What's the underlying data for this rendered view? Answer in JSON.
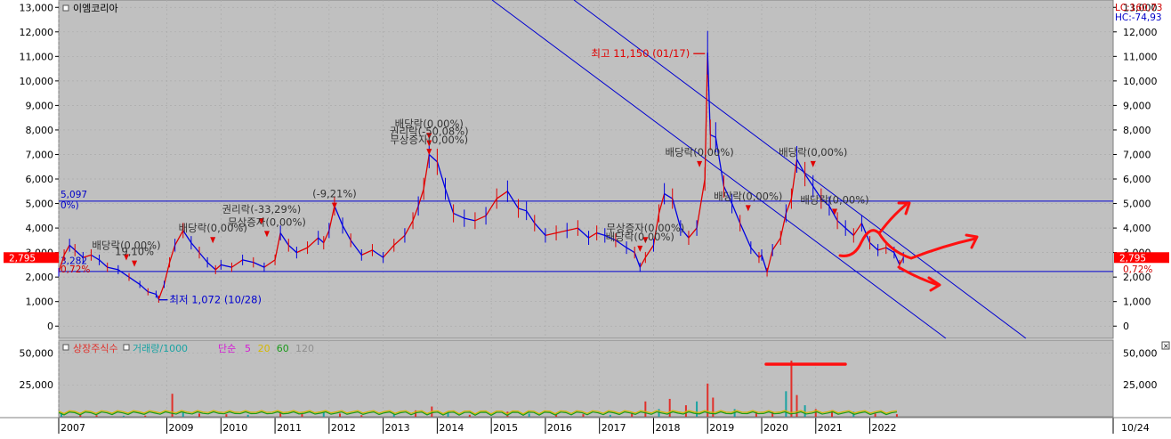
{
  "chart_data": {
    "type": "line",
    "title": "이엠코리아",
    "lc_label": "LC:160,73",
    "hc_label": "HC:-74,93",
    "price_axis": {
      "ticks": [
        0,
        1000,
        2000,
        3000,
        4000,
        5000,
        6000,
        7000,
        8000,
        9000,
        10000,
        11000,
        12000,
        13000
      ],
      "tick_labels": [
        "0",
        "1,000",
        "2,000",
        "3,000",
        "4,000",
        "5,000",
        "6,000",
        "7,000",
        "8,000",
        "9,000",
        "10,000",
        "11,000",
        "12,000",
        "13,000"
      ],
      "ylim": [
        -500,
        13300
      ]
    },
    "x_axis": {
      "xlim": [
        2007.0,
        2026.5
      ],
      "year_labels": [
        "2007",
        "2009",
        "2010",
        "2011",
        "2012",
        "2013",
        "2014",
        "2015",
        "2016",
        "2017",
        "2018",
        "2019",
        "2020",
        "2021",
        "2022"
      ],
      "year_positions": [
        2007,
        2009,
        2010,
        2011,
        2012,
        2013,
        2014,
        2015,
        2016,
        2017,
        2018,
        2019,
        2020,
        2021,
        2022
      ],
      "end_label": "10/24"
    },
    "current_price_label": "2,795",
    "current_price": 2795,
    "ref_lines": [
      {
        "value": 5097,
        "label": "5,097"
      },
      {
        "value": 2230,
        "label": "0,72%"
      }
    ],
    "right_pct_label": "0,72%",
    "left_small_labels": [
      "0%)",
      "3,282"
    ],
    "high_annotation": {
      "label": "최고 11,150 (01/17)",
      "date": 2019.0,
      "value": 11150
    },
    "low_annotation": {
      "label": "최저 1,072 (10/28)",
      "date": 2008.85,
      "value": 1072
    },
    "price_series": {
      "x": [
        2007.0,
        2007.1,
        2007.2,
        2007.3,
        2007.45,
        2007.6,
        2007.75,
        2007.9,
        2008.1,
        2008.3,
        2008.5,
        2008.65,
        2008.8,
        2008.85,
        2008.95,
        2009.05,
        2009.15,
        2009.3,
        2009.45,
        2009.6,
        2009.75,
        2009.9,
        2010.0,
        2010.2,
        2010.4,
        2010.6,
        2010.8,
        2011.0,
        2011.1,
        2011.25,
        2011.4,
        2011.6,
        2011.8,
        2011.9,
        2012.0,
        2012.1,
        2012.25,
        2012.4,
        2012.6,
        2012.8,
        2013.0,
        2013.2,
        2013.4,
        2013.55,
        2013.65,
        2013.75,
        2013.85,
        2014.0,
        2014.15,
        2014.3,
        2014.5,
        2014.7,
        2014.9,
        2015.1,
        2015.3,
        2015.5,
        2015.65,
        2015.8,
        2016.0,
        2016.2,
        2016.4,
        2016.6,
        2016.8,
        2016.95,
        2017.1,
        2017.3,
        2017.5,
        2017.65,
        2017.75,
        2017.85,
        2018.0,
        2018.1,
        2018.2,
        2018.35,
        2018.5,
        2018.65,
        2018.8,
        2018.95,
        2019.0,
        2019.05,
        2019.15,
        2019.3,
        2019.45,
        2019.6,
        2019.8,
        2019.95,
        2020.0,
        2020.1,
        2020.2,
        2020.35,
        2020.45,
        2020.55,
        2020.65,
        2020.8,
        2020.95,
        2021.1,
        2021.25,
        2021.4,
        2021.55,
        2021.7,
        2021.85,
        2022.0,
        2022.15,
        2022.3,
        2022.45,
        2022.55,
        2022.62
      ],
      "y": [
        2200,
        2900,
        3300,
        3100,
        2800,
        2900,
        2700,
        2400,
        2300,
        2000,
        1700,
        1400,
        1300,
        1100,
        1700,
        2600,
        3300,
        3900,
        3400,
        3000,
        2600,
        2300,
        2500,
        2400,
        2700,
        2600,
        2400,
        2700,
        3800,
        3300,
        3000,
        3200,
        3600,
        3400,
        3900,
        4900,
        4100,
        3500,
        2900,
        3100,
        2800,
        3300,
        3700,
        4300,
        4900,
        5600,
        7000,
        6700,
        5600,
        4600,
        4400,
        4300,
        4500,
        5200,
        5500,
        4800,
        4700,
        4200,
        3700,
        3800,
        3900,
        4000,
        3600,
        3800,
        3700,
        3500,
        3200,
        3000,
        2400,
        2800,
        3300,
        4600,
        5400,
        5200,
        4000,
        3600,
        4000,
        6000,
        11150,
        7800,
        7700,
        5700,
        5000,
        4200,
        3200,
        2800,
        2900,
        2200,
        3100,
        3600,
        4600,
        5200,
        6800,
        6200,
        5700,
        5200,
        4900,
        4300,
        4000,
        3700,
        4200,
        3400,
        3100,
        3200,
        3000,
        2500,
        2795
      ]
    },
    "volume_axis": {
      "ticks": [
        25000,
        50000
      ],
      "tick_labels": [
        "25,000",
        "50,000"
      ],
      "ylim": [
        0,
        60000
      ]
    },
    "volume_legend": [
      {
        "label": "상장주식수",
        "color": "#e0302a"
      },
      {
        "label": "거래량/1000",
        "color": "#1aa3a3"
      },
      {
        "label": "단순",
        "color": "#d51ad5"
      },
      {
        "label": "5",
        "color": "#d51ad5"
      },
      {
        "label": "20",
        "color": "#d6b800"
      },
      {
        "label": "60",
        "color": "#1a9a1a"
      },
      {
        "label": "120",
        "color": "#8f8f8f"
      }
    ],
    "volume_series": {
      "x": [
        2007.05,
        2007.4,
        2007.7,
        2008.2,
        2008.6,
        2009.1,
        2009.3,
        2009.6,
        2010.1,
        2010.5,
        2011.1,
        2011.5,
        2011.9,
        2012.2,
        2012.6,
        2013.2,
        2013.6,
        2013.9,
        2014.2,
        2014.6,
        2015.3,
        2015.7,
        2016.2,
        2016.7,
        2017.2,
        2017.6,
        2017.85,
        2018.1,
        2018.3,
        2018.6,
        2018.8,
        2019.0,
        2019.1,
        2019.5,
        2019.9,
        2020.2,
        2020.45,
        2020.55,
        2020.65,
        2020.8,
        2021.0,
        2021.3,
        2021.7,
        2022.1,
        2022.5
      ],
      "y": [
        3000,
        1500,
        1200,
        800,
        900,
        18000,
        4000,
        2500,
        2000,
        1500,
        4000,
        2200,
        3500,
        2500,
        1200,
        2000,
        5000,
        8000,
        3000,
        1500,
        4000,
        2500,
        1500,
        2000,
        1500,
        3000,
        12000,
        6000,
        14000,
        9000,
        12000,
        26000,
        15000,
        6000,
        4000,
        4000,
        20000,
        44000,
        17000,
        9000,
        6000,
        5000,
        4000,
        2500,
        2000
      ]
    },
    "annotations": [
      {
        "text": "배당락(0,00%)",
        "date": 2008.25,
        "value": 3150
      },
      {
        "text": "19,10%",
        "date": 2008.4,
        "value": 2890
      },
      {
        "text": "배당락(0,00%)",
        "date": 2009.85,
        "value": 3850
      },
      {
        "text": "권리락(-33,29%)",
        "date": 2010.75,
        "value": 4620
      },
      {
        "text": "무상증자(0,00%)",
        "date": 2010.85,
        "value": 4100
      },
      {
        "text": "(-9,21%)",
        "date": 2012.1,
        "value": 5250
      },
      {
        "text": "배당락(0,00%)",
        "date": 2013.85,
        "value": 8100
      },
      {
        "text": "권리락(-50,08%)",
        "date": 2013.85,
        "value": 7800
      },
      {
        "text": "무상증자(0,00%)",
        "date": 2013.85,
        "value": 7450
      },
      {
        "text": "무상증자(0,00%)",
        "date": 2017.85,
        "value": 3850
      },
      {
        "text": "배당락(0,00%)",
        "date": 2017.75,
        "value": 3500
      },
      {
        "text": "배당락(0,00%)",
        "date": 2018.85,
        "value": 6950
      },
      {
        "text": "배당락(0,00%)",
        "date": 2019.75,
        "value": 5150
      },
      {
        "text": "배당락(0,00%)",
        "date": 2020.95,
        "value": 6950
      },
      {
        "text": "배당락(0,00%)",
        "date": 2021.35,
        "value": 5000
      }
    ]
  }
}
